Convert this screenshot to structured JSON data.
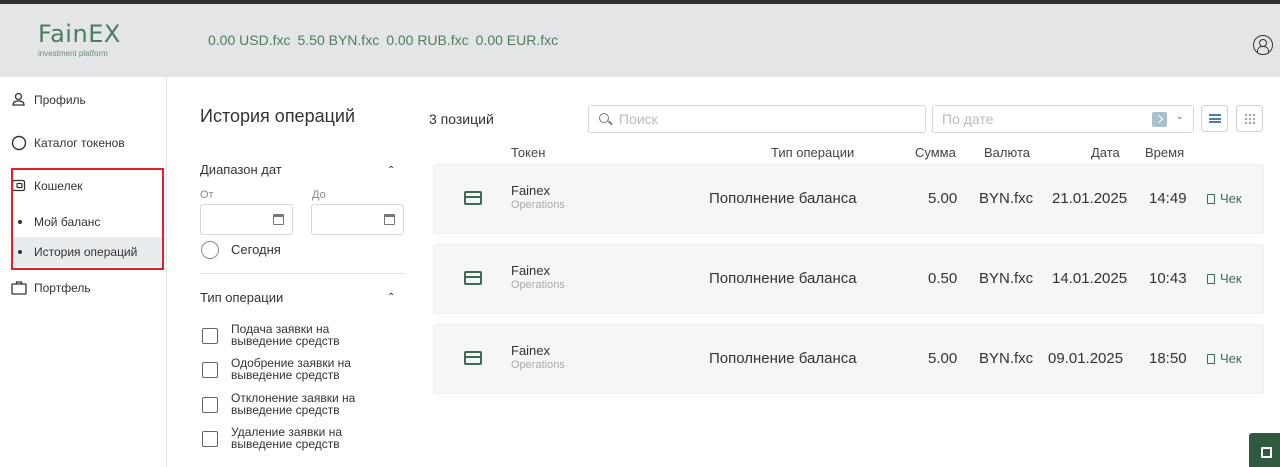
{
  "brand": {
    "name": "FainEX",
    "tagline": "investment platform"
  },
  "balances": [
    "0.00 USD.fxc",
    "5.50 BYN.fxc",
    "0.00 RUB.fxc",
    "0.00 EUR.fxc"
  ],
  "sidebar": {
    "items": [
      {
        "label": "Профиль",
        "icon": "user-icon"
      },
      {
        "label": "Каталог токенов",
        "icon": "circle-icon"
      },
      {
        "label": "Кошелек",
        "icon": "wallet-icon"
      },
      {
        "label": "Портфель",
        "icon": "briefcase-icon"
      }
    ],
    "wallet_sub": [
      {
        "label": "Мой баланс",
        "active": false
      },
      {
        "label": "История операций",
        "active": true
      }
    ]
  },
  "filters": {
    "title": "История операций",
    "date_range": {
      "title": "Диапазон дат",
      "from_label": "От",
      "to_label": "До",
      "today_label": "Сегодня"
    },
    "op_type": {
      "title": "Тип операции",
      "options": [
        "Подача заявки на выведение средств",
        "Одобрение заявки на выведение средств",
        "Отклонение заявки на выведение средств",
        "Удаление заявки на выведение средств"
      ]
    }
  },
  "toolbar": {
    "count": "3 позиций",
    "search_placeholder": "Поиск",
    "date_placeholder": "По дате"
  },
  "table": {
    "headers": {
      "token": "Токен",
      "type": "Тип операции",
      "amount": "Сумма",
      "currency": "Валюта",
      "date": "Дата",
      "time": "Время"
    },
    "rows": [
      {
        "token": "Fainex",
        "token_sub": "Operations",
        "type": "Пополнение баланса",
        "amount": "5.00",
        "currency": "BYN.fxc",
        "date": "21.01.2025",
        "time": "14:49",
        "receipt": "Чек"
      },
      {
        "token": "Fainex",
        "token_sub": "Operations",
        "type": "Пополнение баланса",
        "amount": "0.50",
        "currency": "BYN.fxc",
        "date": "14.01.2025",
        "time": "10:43",
        "receipt": "Чек"
      },
      {
        "token": "Fainex",
        "token_sub": "Operations",
        "type": "Пополнение баланса",
        "amount": "5.00",
        "currency": "BYN.fxc",
        "date": "09.01.2025",
        "time": "18:50",
        "receipt": "Чек"
      }
    ]
  },
  "colors": {
    "brand": "#4b7d5e",
    "accent": "#3e6b4e",
    "highlight": "#e0202a",
    "header_bg": "#e3e5e6"
  }
}
